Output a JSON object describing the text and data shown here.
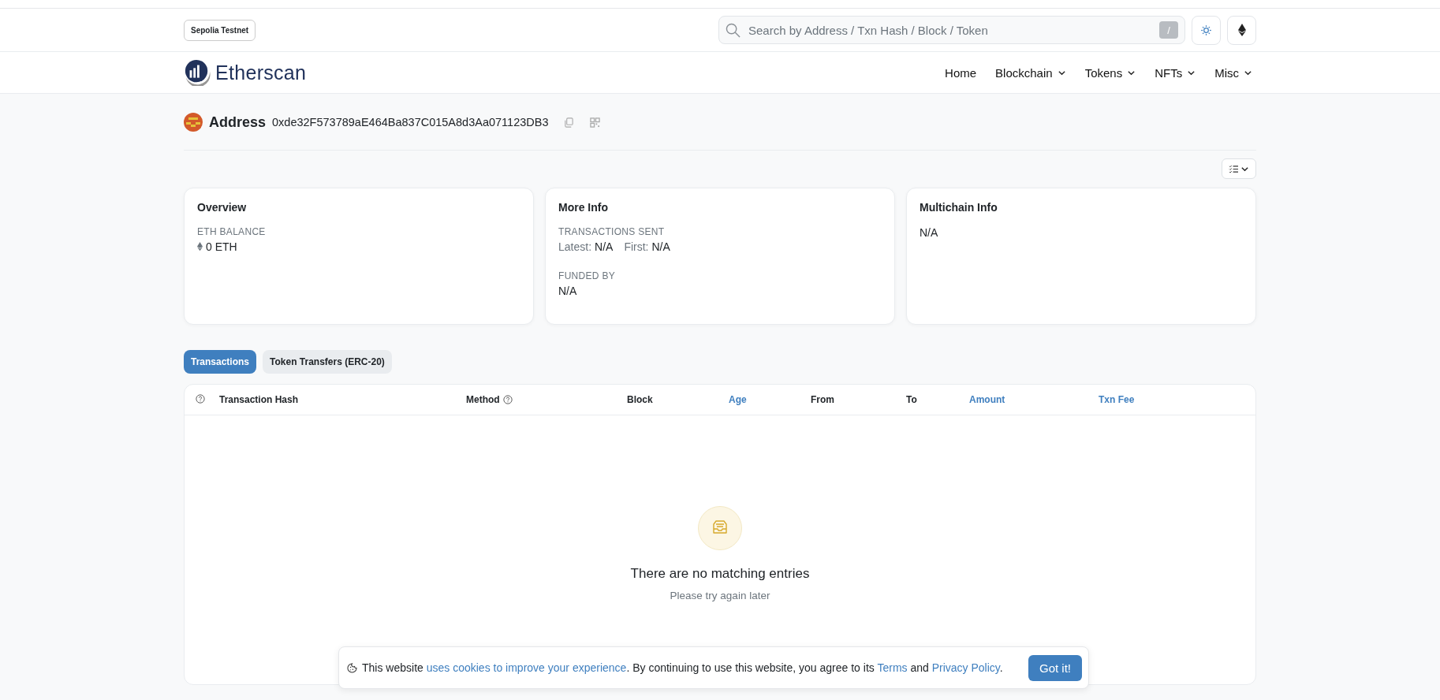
{
  "network_badge": "Sepolia Testnet",
  "search": {
    "placeholder": "Search by Address / Txn Hash / Block / Token",
    "shortcut": "/"
  },
  "logo": "Etherscan",
  "nav": [
    {
      "label": "Home",
      "kind": "link"
    },
    {
      "label": "Blockchain",
      "kind": "dropdown"
    },
    {
      "label": "Tokens",
      "kind": "dropdown"
    },
    {
      "label": "NFTs",
      "kind": "dropdown"
    },
    {
      "label": "Misc",
      "kind": "dropdown"
    }
  ],
  "address": {
    "label": "Address",
    "value": "0xde32F573789aE464Ba837C015A8d3Aa071123DB3"
  },
  "cards": [
    {
      "title": "Overview",
      "fields": [
        {
          "kind": "eth",
          "label": "ETH BALANCE",
          "value": "0 ETH"
        }
      ]
    },
    {
      "title": "More Info",
      "fields": [
        {
          "kind": "pairs",
          "label": "TRANSACTIONS SENT",
          "pairs": [
            {
              "key": "Latest:",
              "value": "N/A"
            },
            {
              "key": "First:",
              "value": "N/A"
            }
          ]
        },
        {
          "kind": "plain",
          "label": "FUNDED BY",
          "value": "N/A"
        }
      ]
    },
    {
      "title": "Multichain Info",
      "fields": [
        {
          "kind": "plain",
          "value": "N/A"
        }
      ]
    }
  ],
  "tabs": [
    {
      "label": "Transactions",
      "selected": true
    },
    {
      "label": "Token Transfers (ERC-20)",
      "selected": false
    }
  ],
  "table": {
    "columns": [
      {
        "label": "Transaction Hash",
        "kind": "helpleading"
      },
      {
        "label": "Method",
        "kind": "helptrailing"
      },
      {
        "label": "Block",
        "kind": "plain"
      },
      {
        "label": "Age",
        "kind": "link"
      },
      {
        "label": "From",
        "kind": "plain"
      },
      {
        "label": "To",
        "kind": "plain"
      },
      {
        "label": "Amount",
        "kind": "link"
      },
      {
        "label": "Txn Fee",
        "kind": "link"
      }
    ],
    "empty_state": {
      "title": "There are no matching entries",
      "subtitle": "Please try again later"
    }
  },
  "cookie_notice": {
    "parts": [
      {
        "text": "This website ",
        "kind": "text"
      },
      {
        "text": "uses cookies to improve your experience",
        "kind": "link"
      },
      {
        "text": ". By continuing to use this website, you agree to its ",
        "kind": "text"
      },
      {
        "text": "Terms",
        "kind": "link"
      },
      {
        "text": " and ",
        "kind": "text"
      },
      {
        "text": "Privacy Policy",
        "kind": "link"
      },
      {
        "text": ".",
        "kind": "text"
      }
    ],
    "button": "Got it!"
  }
}
